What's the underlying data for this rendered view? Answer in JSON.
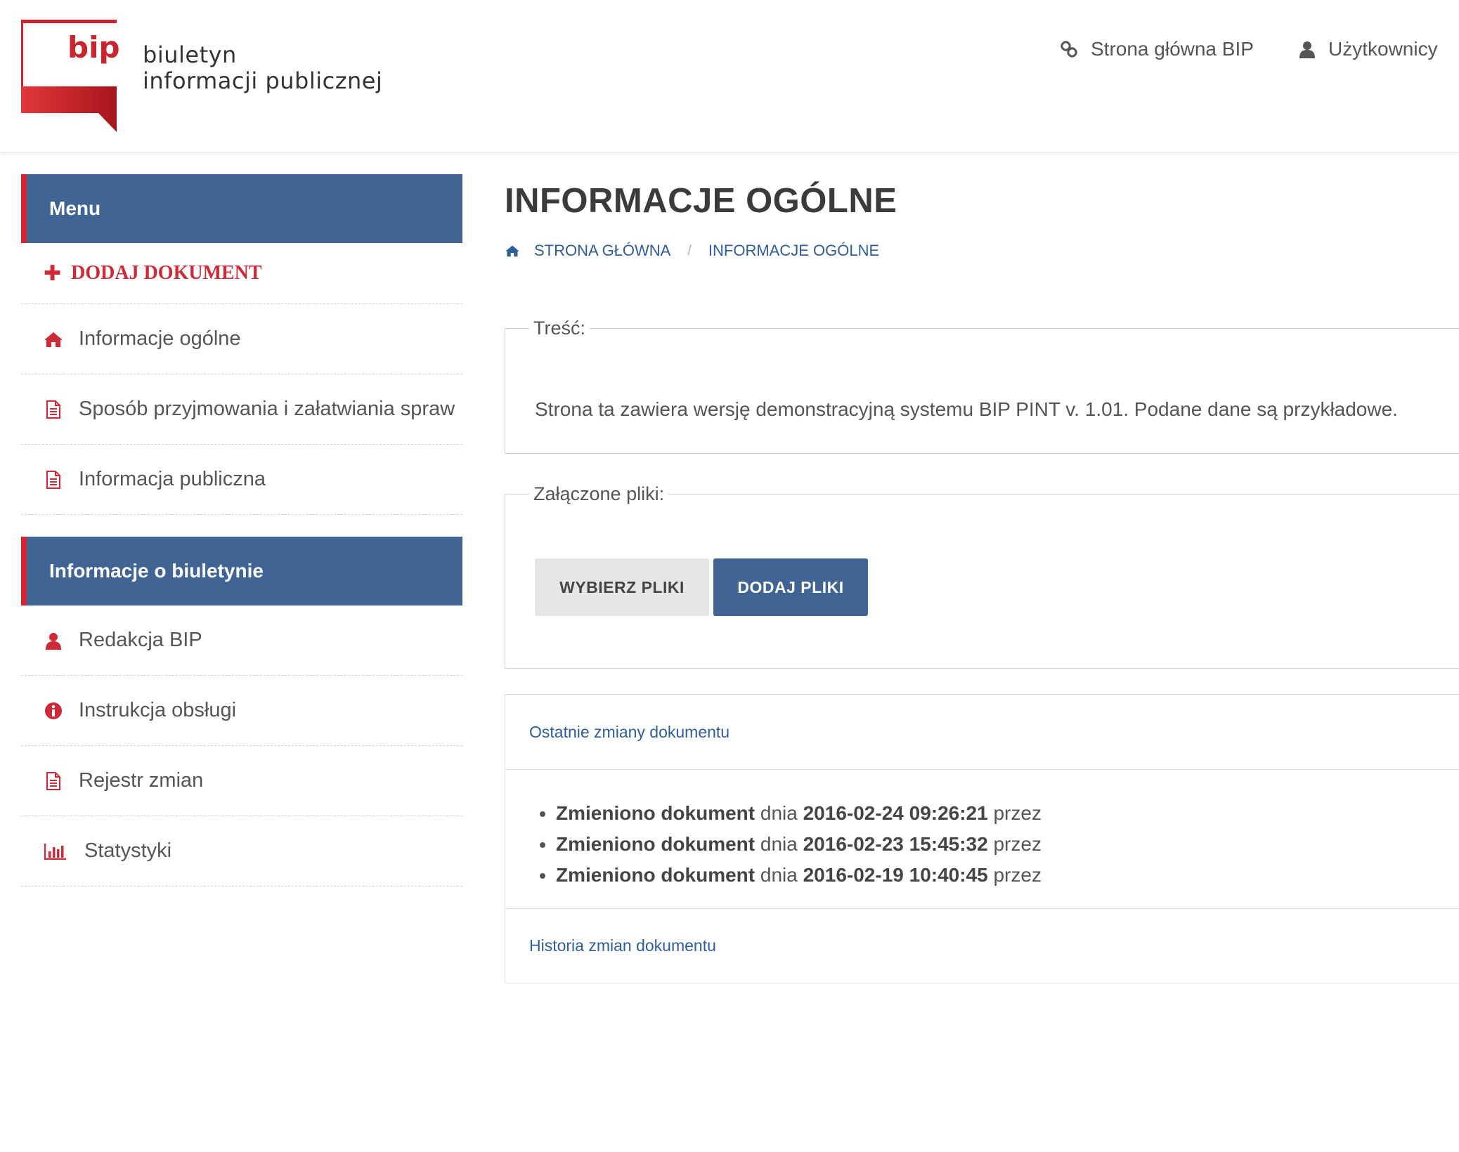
{
  "header": {
    "logo": {
      "mark": "bip",
      "line1": "biuletyn",
      "line2": "informacji publicznej"
    },
    "links": [
      {
        "label": "Strona główna BIP",
        "icon": "link-icon"
      },
      {
        "label": "Użytkownicy",
        "icon": "user-icon"
      }
    ]
  },
  "sidebar": {
    "menu_title": "Menu",
    "add_document": "DODAJ DOKUMENT",
    "menu_items": [
      {
        "label": "Informacje ogólne",
        "icon": "home-icon"
      },
      {
        "label": "Sposób przyjmowania i załatwiania spraw",
        "icon": "document-icon"
      },
      {
        "label": "Informacja publiczna",
        "icon": "document-icon"
      }
    ],
    "info_title": "Informacje o biuletynie",
    "info_items": [
      {
        "label": "Redakcja BIP",
        "icon": "user-icon"
      },
      {
        "label": "Instrukcja obsługi",
        "icon": "info-icon"
      },
      {
        "label": "Rejestr zmian",
        "icon": "document-icon"
      },
      {
        "label": "Statystyki",
        "icon": "bar-chart-icon"
      }
    ]
  },
  "main": {
    "title": "INFORMACJE OGÓLNE",
    "breadcrumb": [
      "STRONA GŁÓWNA",
      "INFORMACJE OGÓLNE"
    ],
    "content_legend": "Treść:",
    "content_text": "Strona ta zawiera wersję demonstracyjną systemu BIP PINT v. 1.01. Podane dane są przykładowe.",
    "files_legend": "Załączone pliki:",
    "choose_files_label": "WYBIERZ PLIKI",
    "add_files_label": "DODAJ PLIKI",
    "changes_title": "Ostatnie zmiany dokumentu",
    "changes": [
      {
        "action": "Zmieniono dokument",
        "word_day": "dnia",
        "datetime": "2016-02-24 09:26:21",
        "word_by": "przez"
      },
      {
        "action": "Zmieniono dokument",
        "word_day": "dnia",
        "datetime": "2016-02-23 15:45:32",
        "word_by": "przez"
      },
      {
        "action": "Zmieniono dokument",
        "word_day": "dnia",
        "datetime": "2016-02-19 10:40:45",
        "word_by": "przez"
      }
    ],
    "history_link": "Historia zmian dokumentu"
  },
  "colors": {
    "brand_red": "#cf2a37",
    "primary_blue": "#406595",
    "link_blue": "#2f5e9a"
  }
}
